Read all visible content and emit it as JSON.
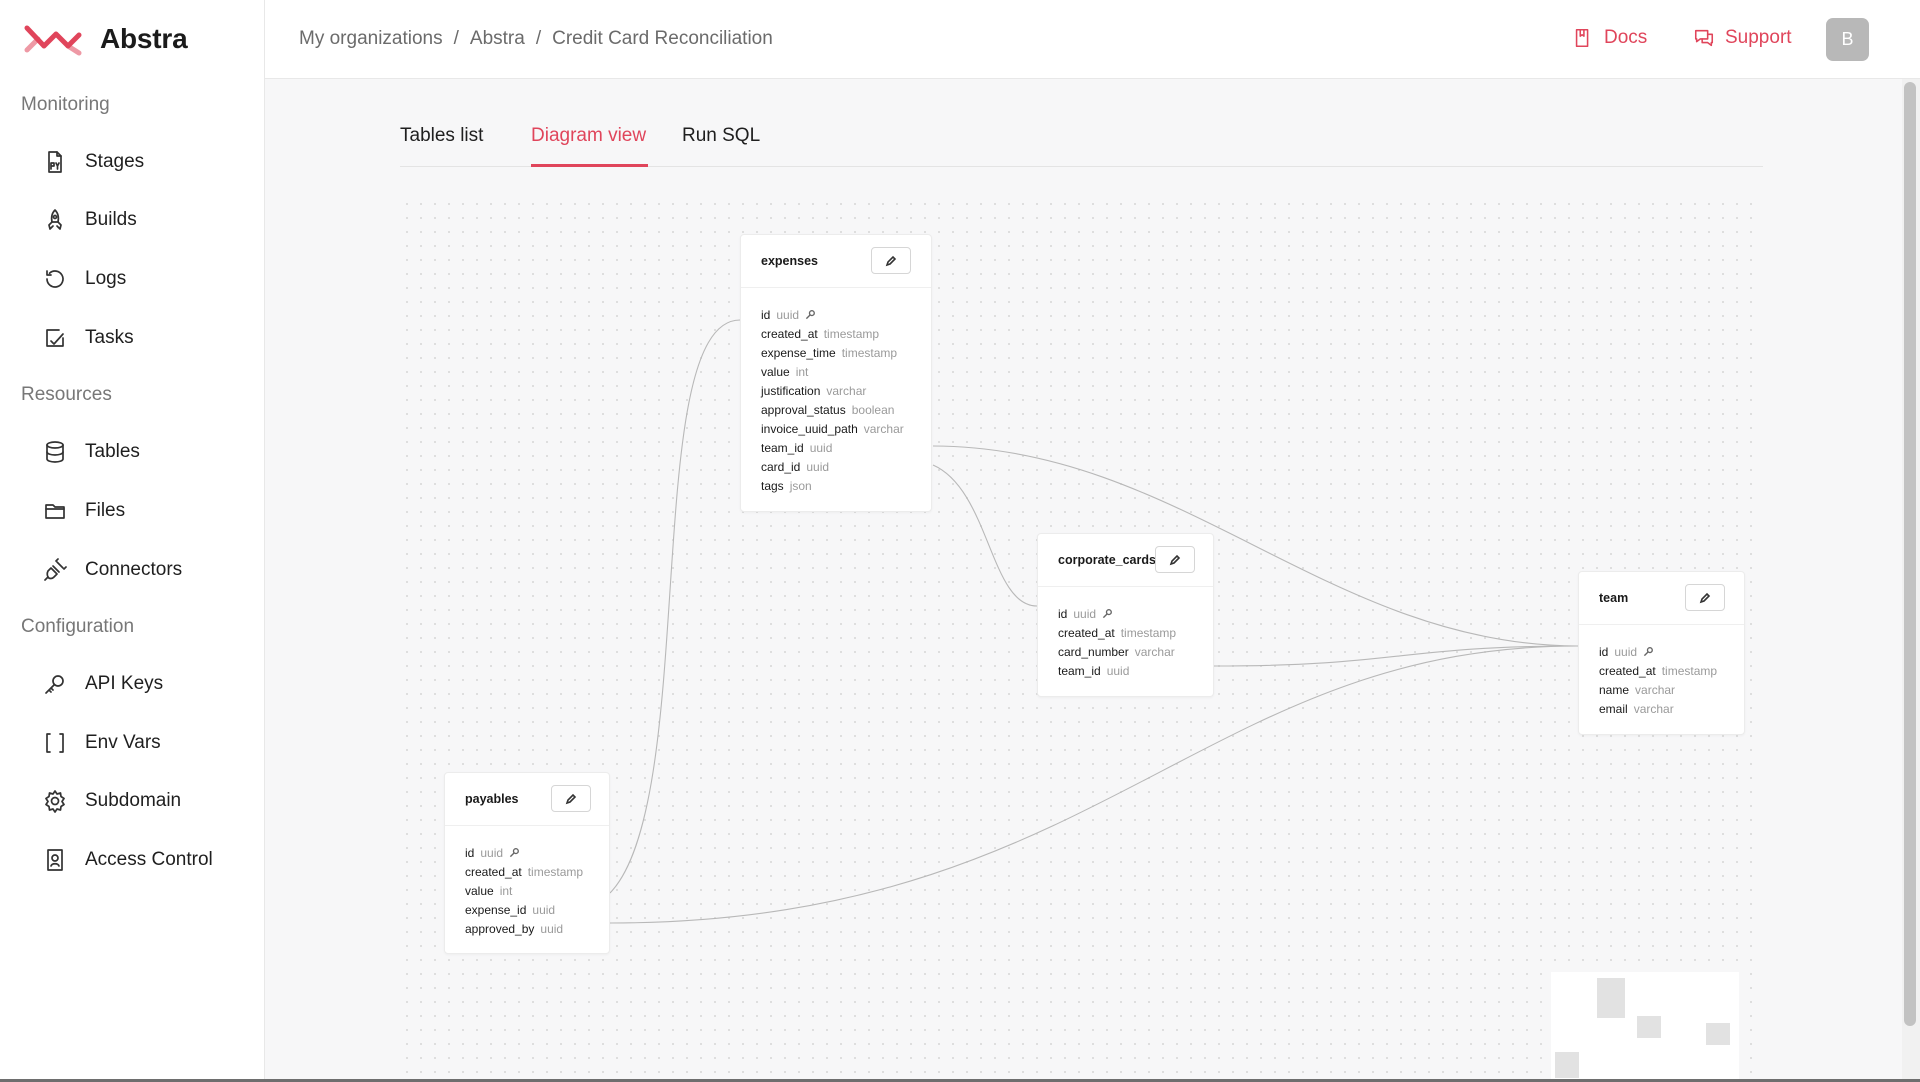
{
  "brand": {
    "name": "Abstra",
    "accent": "#e0455b"
  },
  "sidebar": {
    "sections": [
      {
        "label": "Monitoring",
        "items": [
          {
            "label": "Stages",
            "icon": "python-file-icon"
          },
          {
            "label": "Builds",
            "icon": "rocket-icon"
          },
          {
            "label": "Logs",
            "icon": "history-icon"
          },
          {
            "label": "Tasks",
            "icon": "checkbox-icon"
          }
        ]
      },
      {
        "label": "Resources",
        "items": [
          {
            "label": "Tables",
            "icon": "database-icon"
          },
          {
            "label": "Files",
            "icon": "folder-icon"
          },
          {
            "label": "Connectors",
            "icon": "plug-icon"
          }
        ]
      },
      {
        "label": "Configuration",
        "items": [
          {
            "label": "API Keys",
            "icon": "key-icon"
          },
          {
            "label": "Env Vars",
            "icon": "brackets-icon"
          },
          {
            "label": "Subdomain",
            "icon": "gear-icon"
          },
          {
            "label": "Access Control",
            "icon": "id-badge-icon"
          }
        ]
      }
    ]
  },
  "header": {
    "breadcrumb": [
      "My organizations",
      "Abstra",
      "Credit Card Reconciliation"
    ],
    "separator": "/",
    "docs_label": "Docs",
    "support_label": "Support",
    "avatar_initial": "B"
  },
  "tabs": [
    {
      "label": "Tables list",
      "active": false
    },
    {
      "label": "Diagram view",
      "active": true
    },
    {
      "label": "Run SQL",
      "active": false
    }
  ],
  "diagram": {
    "tables": [
      {
        "name": "expenses",
        "columns": [
          {
            "name": "id",
            "type": "uuid",
            "key": true
          },
          {
            "name": "created_at",
            "type": "timestamp"
          },
          {
            "name": "expense_time",
            "type": "timestamp"
          },
          {
            "name": "value",
            "type": "int"
          },
          {
            "name": "justification",
            "type": "varchar"
          },
          {
            "name": "approval_status",
            "type": "boolean"
          },
          {
            "name": "invoice_uuid_path",
            "type": "varchar"
          },
          {
            "name": "team_id",
            "type": "uuid"
          },
          {
            "name": "card_id",
            "type": "uuid"
          },
          {
            "name": "tags",
            "type": "json"
          }
        ]
      },
      {
        "name": "corporate_cards",
        "columns": [
          {
            "name": "id",
            "type": "uuid",
            "key": true
          },
          {
            "name": "created_at",
            "type": "timestamp"
          },
          {
            "name": "card_number",
            "type": "varchar"
          },
          {
            "name": "team_id",
            "type": "uuid"
          }
        ]
      },
      {
        "name": "team",
        "columns": [
          {
            "name": "id",
            "type": "uuid",
            "key": true
          },
          {
            "name": "created_at",
            "type": "timestamp"
          },
          {
            "name": "name",
            "type": "varchar"
          },
          {
            "name": "email",
            "type": "varchar"
          }
        ]
      },
      {
        "name": "payables",
        "columns": [
          {
            "name": "id",
            "type": "uuid",
            "key": true
          },
          {
            "name": "created_at",
            "type": "timestamp"
          },
          {
            "name": "value",
            "type": "int"
          },
          {
            "name": "expense_id",
            "type": "uuid"
          },
          {
            "name": "approved_by",
            "type": "uuid"
          }
        ]
      }
    ],
    "relations": [
      {
        "from": "expenses.team_id",
        "to": "team.id"
      },
      {
        "from": "expenses.card_id",
        "to": "corporate_cards.id"
      },
      {
        "from": "corporate_cards.team_id",
        "to": "team.id"
      },
      {
        "from": "payables.expense_id",
        "to": "expenses.id"
      },
      {
        "from": "payables.approved_by",
        "to": "team.id"
      }
    ]
  }
}
